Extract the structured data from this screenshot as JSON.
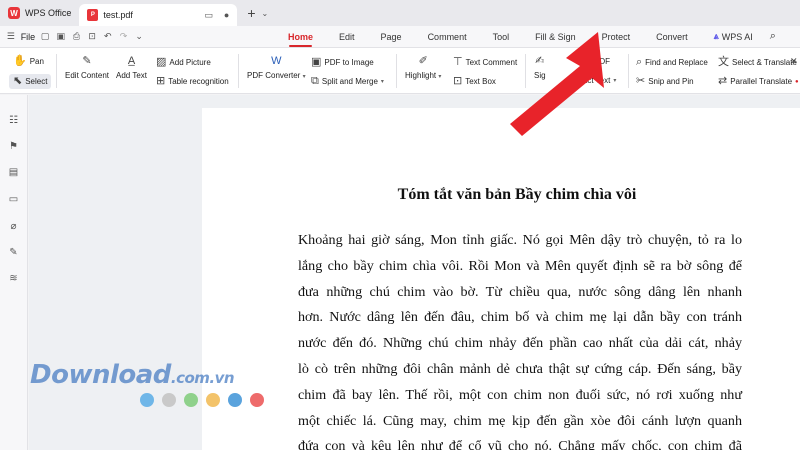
{
  "titlebar": {
    "app_name": "WPS Office",
    "doc_tab": "test.pdf",
    "new_tab": "+"
  },
  "menubar": {
    "file_label": "File",
    "tabs": [
      {
        "label": "Home",
        "active": true
      },
      {
        "label": "Edit"
      },
      {
        "label": "Page"
      },
      {
        "label": "Comment"
      },
      {
        "label": "Tool"
      },
      {
        "label": "Fill & Sign"
      },
      {
        "label": "Protect"
      },
      {
        "label": "Convert"
      },
      {
        "label": "WPS AI"
      }
    ]
  },
  "ribbon": {
    "pan": "Pan",
    "select": "Select",
    "edit_content": "Edit Content",
    "add_text": "Add Text",
    "add_picture": "Add Picture",
    "table_recognition": "Table recognition",
    "pdf_converter": "PDF Converter",
    "pdf_to_image": "PDF to Image",
    "split_merge": "Split and Merge",
    "highlight": "Highlight",
    "text_comment": "Text Comment",
    "text_box": "Text Box",
    "sig_partial": "Sig",
    "r_pdf": "R PDF",
    "extract_text": "tract Text",
    "find_replace": "Find and Replace",
    "snip_pin": "Snip and Pin",
    "select_translate": "Select & Translate",
    "parallel_translate": "Parallel Translate"
  },
  "document": {
    "title": "Tóm tắt văn bản Bầy chim chìa vôi",
    "lines": [
      "Khoảng hai giờ sáng, Mon tỉnh giấc. Nó gọi Mên dậy trò chuyện, tỏ ra lo",
      "lắng cho bầy chim chìa vôi. Rồi Mon và Mên quyết định sẽ ra bờ sông để",
      "đưa những chú chim vào bờ. Từ chiều qua, nước sông dâng lên nhanh",
      "hơn. Nước dâng lên đến đâu, chim bố và chim mẹ lại dẫn bầy con tránh",
      "nước đến đó. Những chú chim nhảy đến phần cao nhất của dải cát, nhảy",
      "lò cò trên những đôi chân mảnh dẻ chưa thật sự cứng cáp. Đến sáng, bầy",
      "chim đã bay lên. Thế rồi, một con chim non đuối sức, nó rơi xuống như",
      "một chiếc lá. Cũng may, chim mẹ kịp đến gần xòe đôi cánh lượn quanh",
      "đứa con và kêu lên như để cổ vũ cho nó. Chẳng mấy chốc, con chim đã"
    ]
  },
  "watermark": {
    "main": "Download",
    "domain": ".com.vn",
    "dot_colors": [
      "#6fb6e8",
      "#c9c9c9",
      "#8fd18b",
      "#f3c36a",
      "#5aa3dd",
      "#ee6b6b"
    ]
  },
  "colors": {
    "accent": "#d8262b",
    "arrow": "#e8232a"
  }
}
